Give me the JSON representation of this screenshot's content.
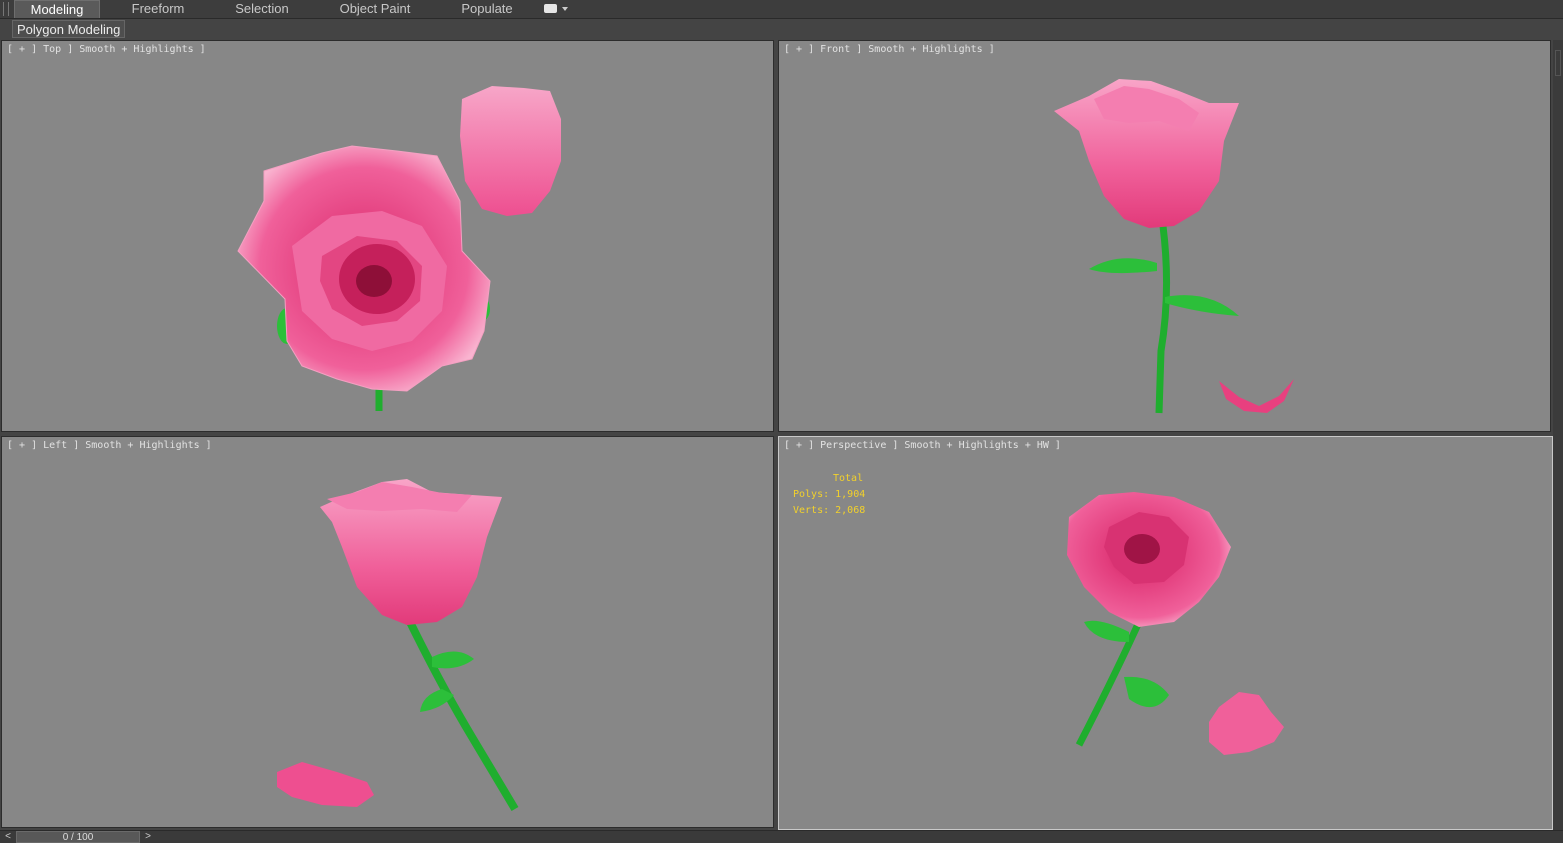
{
  "ribbon": {
    "tabs": [
      {
        "label": "Modeling",
        "active": true
      },
      {
        "label": "Freeform",
        "active": false
      },
      {
        "label": "Selection",
        "active": false
      },
      {
        "label": "Object Paint",
        "active": false
      },
      {
        "label": "Populate",
        "active": false
      }
    ],
    "options_icon": "ribbon-options-icon"
  },
  "subribbon": {
    "panel_label": "Polygon Modeling"
  },
  "viewports": {
    "top": {
      "label": "[ + ] Top ] Smooth + Highlights ]"
    },
    "front": {
      "label": "[ + ] Front ] Smooth + Highlights ]"
    },
    "left": {
      "label": "[ + ] Left ] Smooth + Highlights ]"
    },
    "perspective": {
      "label": "[ + ] Perspective ] Smooth + Highlights + HW ]",
      "stats": {
        "title": "Total",
        "polys": "Polys: 1,904",
        "verts": "Verts: 2,068"
      }
    }
  },
  "timeline": {
    "prev": "<",
    "next": ">",
    "frame": "0 / 100"
  },
  "colors": {
    "viewport_bg": "#878787",
    "petal": "#f0609a",
    "petal_light": "#f9a8c8",
    "petal_dark": "#c2185b",
    "stem": "#1fae2e",
    "stats_text": "#f2d12b"
  }
}
